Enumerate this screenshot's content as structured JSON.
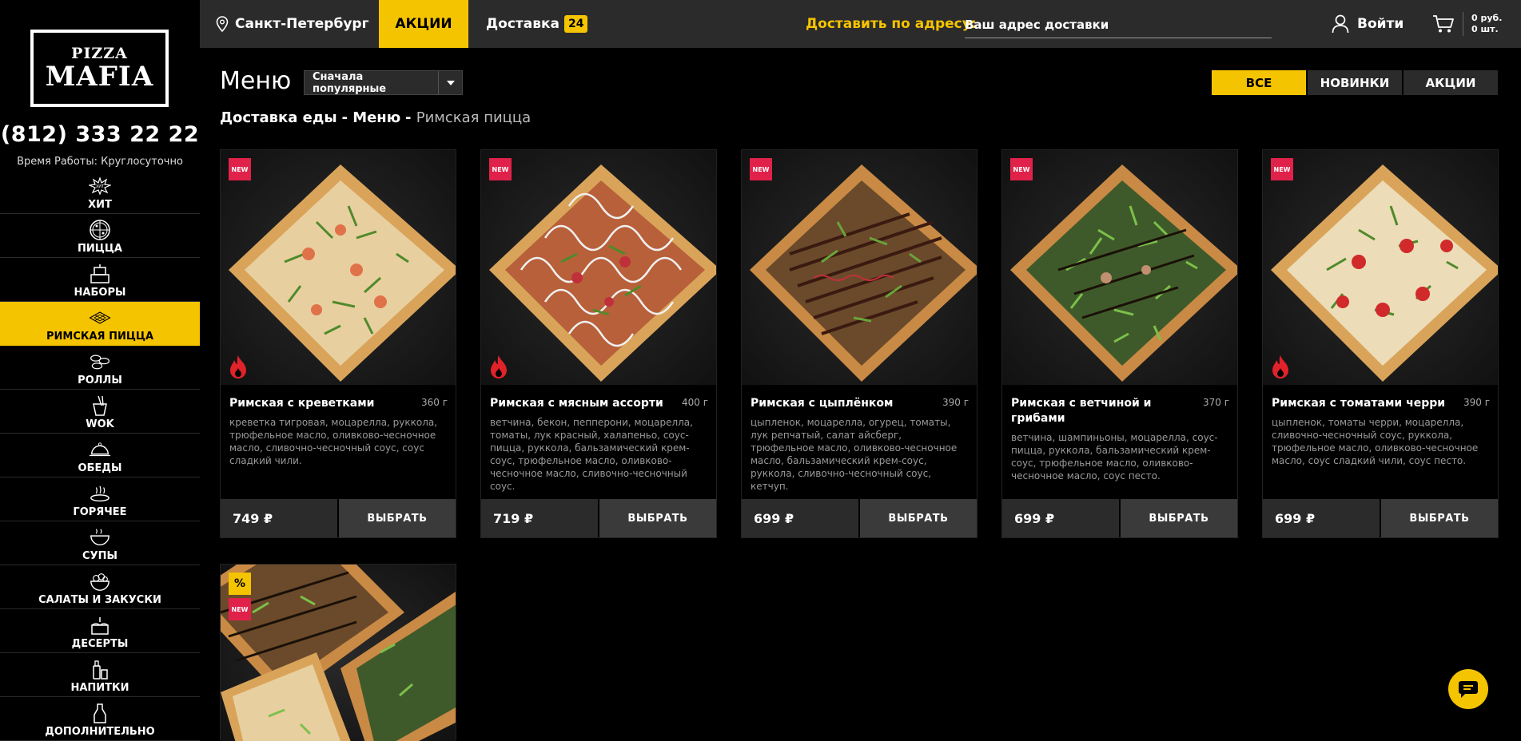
{
  "sidebar": {
    "logo_line1": "PIZZA",
    "logo_line2": "MAFIA",
    "phone": "(812) 333 22 22",
    "hours": "Время Работы: Круглосуточно",
    "items": [
      {
        "label": "ХИТ",
        "icon": "hit-icon"
      },
      {
        "label": "ПИЦЦА",
        "icon": "pizza-icon"
      },
      {
        "label": "НАБОРЫ",
        "icon": "sets-icon"
      },
      {
        "label": "РИМСКАЯ ПИЦЦА",
        "icon": "roman-pizza-icon",
        "active": true
      },
      {
        "label": "РОЛЛЫ",
        "icon": "rolls-icon"
      },
      {
        "label": "WOK",
        "icon": "wok-icon"
      },
      {
        "label": "ОБЕДЫ",
        "icon": "cloche-icon"
      },
      {
        "label": "ГОРЯЧЕЕ",
        "icon": "hot-dish-icon"
      },
      {
        "label": "СУПЫ",
        "icon": "soup-icon"
      },
      {
        "label": "САЛАТЫ И ЗАКУСКИ",
        "icon": "salad-icon"
      },
      {
        "label": "ДЕСЕРТЫ",
        "icon": "cake-icon"
      },
      {
        "label": "НАПИТКИ",
        "icon": "drinks-icon"
      },
      {
        "label": "ДОПОЛНИТЕЛЬНО",
        "icon": "sauce-icon"
      }
    ]
  },
  "topbar": {
    "city": "Санкт-Петербург",
    "promo": "АКЦИИ",
    "delivery": "Доставка",
    "delivery_badge": "24",
    "address_label": "Доставить по адресу:",
    "address_placeholder": "Ваш адрес доставки",
    "login": "Войти",
    "cart_sum": "0 руб.",
    "cart_count": "0 шт."
  },
  "main": {
    "title": "Меню",
    "sort_value": "Сначала популярные",
    "filters": [
      "ВСЕ",
      "НОВИНКИ",
      "АКЦИИ"
    ],
    "active_filter": "ВСЕ",
    "breadcrumbs": [
      "Доставка еды",
      "Меню",
      "Римская пицца"
    ]
  },
  "products": [
    {
      "name": "Римская с креветками",
      "weight": "360 г",
      "desc": "креветка тигровая, моцарелла, руккола, трюфельное масло, оливково-чесночное масло, сливочно-чесночный соус, соус сладкий чили.",
      "price": "749 ₽",
      "button": "ВЫБРАТЬ",
      "badge_new": "NEW",
      "hot": true
    },
    {
      "name": "Римская с мясным ассорти",
      "weight": "400 г",
      "desc": "ветчина, бекон, пепперони, моцарелла, томаты, лук красный, халапеньо, соус-пицца, руккола, бальзамический крем-соус, трюфельное масло, оливково-чесночное масло, сливочно-чесночный соус.",
      "price": "719 ₽",
      "button": "ВЫБРАТЬ",
      "badge_new": "NEW",
      "hot": true
    },
    {
      "name": "Римская с цыплёнком",
      "weight": "390 г",
      "desc": "цыпленок, моцарелла, огурец, томаты, лук репчатый, салат айсберг, трюфельное масло, оливково-чесночное масло, бальзамический крем-соус, руккола, сливочно-чесночный соус, кетчуп.",
      "price": "699 ₽",
      "button": "ВЫБРАТЬ",
      "badge_new": "NEW",
      "hot": false
    },
    {
      "name": "Римская с ветчиной и грибами",
      "weight": "370 г",
      "desc": "ветчина, шампиньоны, моцарелла, соус-пицца, руккола, бальзамический крем-соус, трюфельное масло, оливково-чесночное масло, соус песто.",
      "price": "699 ₽",
      "button": "ВЫБРАТЬ",
      "badge_new": "NEW",
      "hot": false
    },
    {
      "name": "Римская с томатами черри",
      "weight": "390 г",
      "desc": "цыпленок, томаты черри, моцарелла, сливочно-чесночный соус, руккола, трюфельное масло, оливково-чесночное масло, соус сладкий чили, соус песто.",
      "price": "699 ₽",
      "button": "ВЫБРАТЬ",
      "badge_new": "NEW",
      "hot": true
    },
    {
      "badge_new": "NEW",
      "badge_promo": "%"
    }
  ],
  "colors": {
    "accent": "#f5c400",
    "new_badge": "#e0224a",
    "topbar": "#2b2b2b",
    "background": "#000000"
  }
}
